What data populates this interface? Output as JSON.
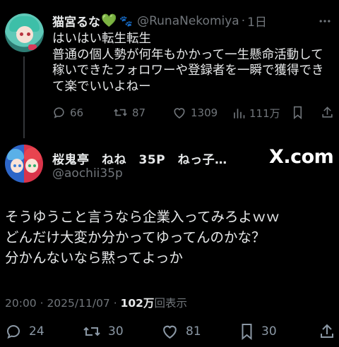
{
  "colors": {
    "background": "#000000",
    "text": "#e7e9ea",
    "muted": "#71767b",
    "heart_emoji": "#51c84a"
  },
  "top_tweet": {
    "author_name": "猫宮るな",
    "emoji_heart": "💚",
    "emoji_paw": "🐾",
    "handle": "@RunaNekomiya",
    "separator": "·",
    "time": "1日",
    "text_lines": [
      "はいはい転生転生",
      "普通の個人勢が何年もかかって一生懸命活動して",
      "稼いできたフォロワーや登録者を一瞬で獲得でき",
      "て楽でいいよねー"
    ],
    "actions": {
      "replies": "66",
      "reposts": "87",
      "likes": "1309",
      "views": "111万"
    }
  },
  "main_tweet": {
    "author_name": "桜鬼亭　ねね　35P　ねっ子…",
    "handle": "@aochii35p",
    "brand": "X.com",
    "text_lines": [
      "そうゆうこと言うなら企業入ってみろよｗｗ",
      "どんだけ大変か分かってゆってんのかな？",
      "分かんないなら黙ってよっか"
    ],
    "timestamp": "20:00 · 2025/11/07 · ",
    "views_count": "102万",
    "views_label": "回表示",
    "actions": {
      "replies": "24",
      "reposts": "30",
      "likes": "81",
      "bookmarks": "30"
    }
  }
}
